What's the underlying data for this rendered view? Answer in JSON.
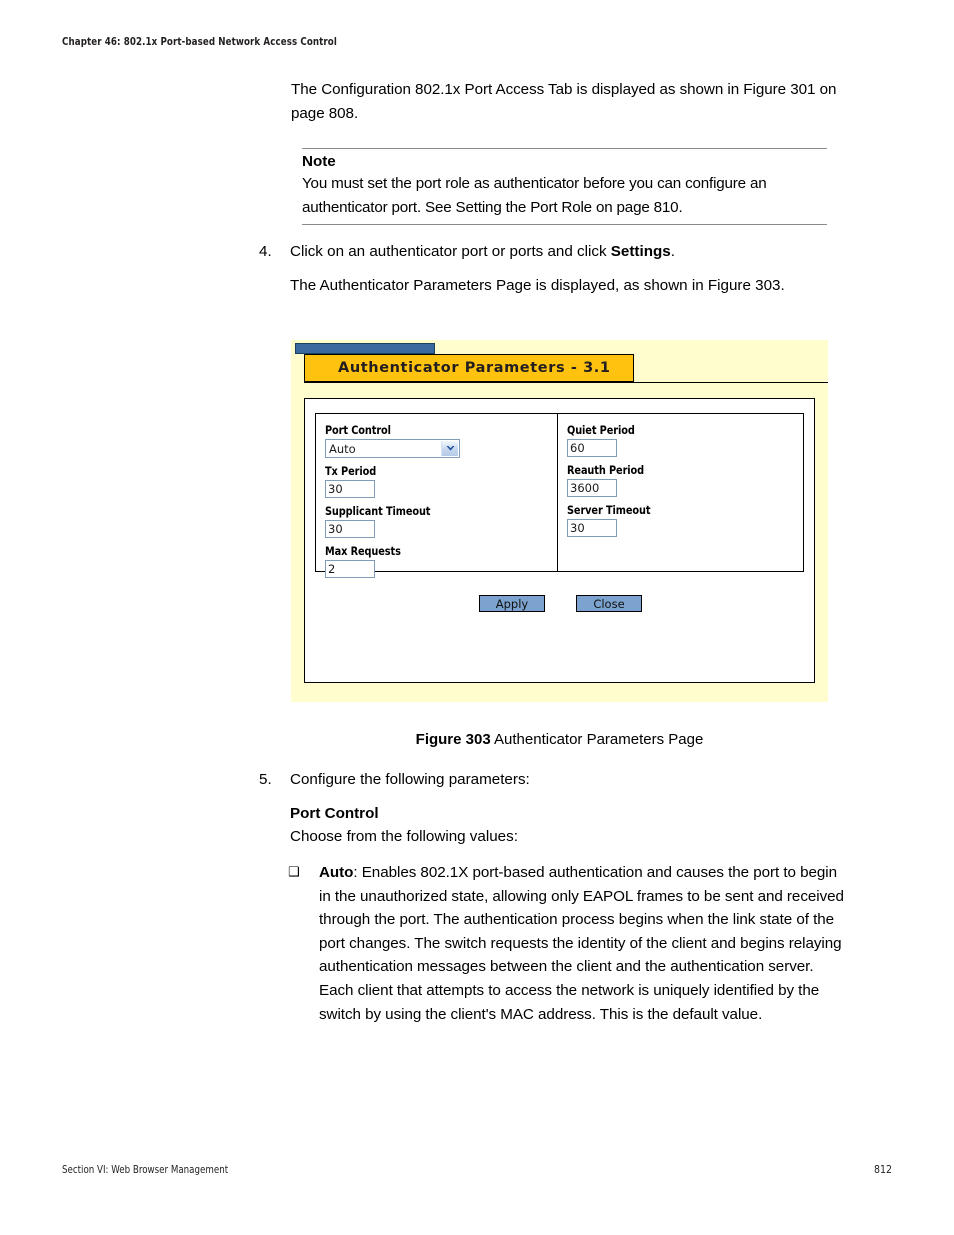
{
  "page": {
    "running_head": "Chapter 46: 802.1x Port-based Network Access Control",
    "footer_left": "Section VI: Web Browser Management",
    "footer_page": "812"
  },
  "intro": {
    "paragraph": "The Configuration 802.1x Port Access Tab is displayed as shown in Figure 301 on page 808."
  },
  "note": {
    "title": "Note",
    "text": "You must set the port role as authenticator before you can configure an authenticator port. See Setting the Port Role on page 810."
  },
  "steps": [
    {
      "number": "4.",
      "line1_prefix": "Click on an authenticator port or ports and click ",
      "line1_bold": "Settings",
      "line1_suffix": ".",
      "line2": "The Authenticator Parameters Page is displayed, as shown in Figure 303."
    },
    {
      "number": "5.",
      "line1": "Configure the following parameters:",
      "subhead": "Port Control",
      "line2": "Choose from the following values:"
    }
  ],
  "bullets": [
    {
      "marker": "❑",
      "term": "Auto",
      "text": ": Enables 802.1X port-based authentication and causes the port to begin in the unauthorized state, allowing only EAPOL frames to be sent and received through the port. The authentication process begins when the link state of the port changes. The switch requests the identity of the client and begins relaying authentication messages between the client and the authentication server. Each client that attempts to access the network is uniquely identified by the switch by using the client's MAC address. This is the default value."
    }
  ],
  "figure": {
    "caption_number": "Figure 303",
    "caption_text": "Authenticator Parameters Page",
    "window_title": "Authenticator Parameters - 3.1",
    "colors": {
      "page_background": "#fffdce",
      "title_tab": "#ffc20e",
      "blue_bar": "#39699f",
      "button": "#7ca3cf",
      "input_border": "#7f9db9"
    },
    "fields_left": [
      {
        "label": "Port Control",
        "value": "Auto",
        "type": "select"
      },
      {
        "label": "Tx Period",
        "value": "30",
        "type": "text"
      },
      {
        "label": "Supplicant Timeout",
        "value": "30",
        "type": "text"
      },
      {
        "label": "Max Requests",
        "value": "2",
        "type": "text"
      }
    ],
    "fields_right": [
      {
        "label": "Quiet Period",
        "value": "60",
        "type": "text"
      },
      {
        "label": "Reauth Period",
        "value": "3600",
        "type": "text"
      },
      {
        "label": "Server Timeout",
        "value": "30",
        "type": "text"
      }
    ],
    "buttons": [
      {
        "label": "Apply"
      },
      {
        "label": "Close"
      }
    ]
  }
}
